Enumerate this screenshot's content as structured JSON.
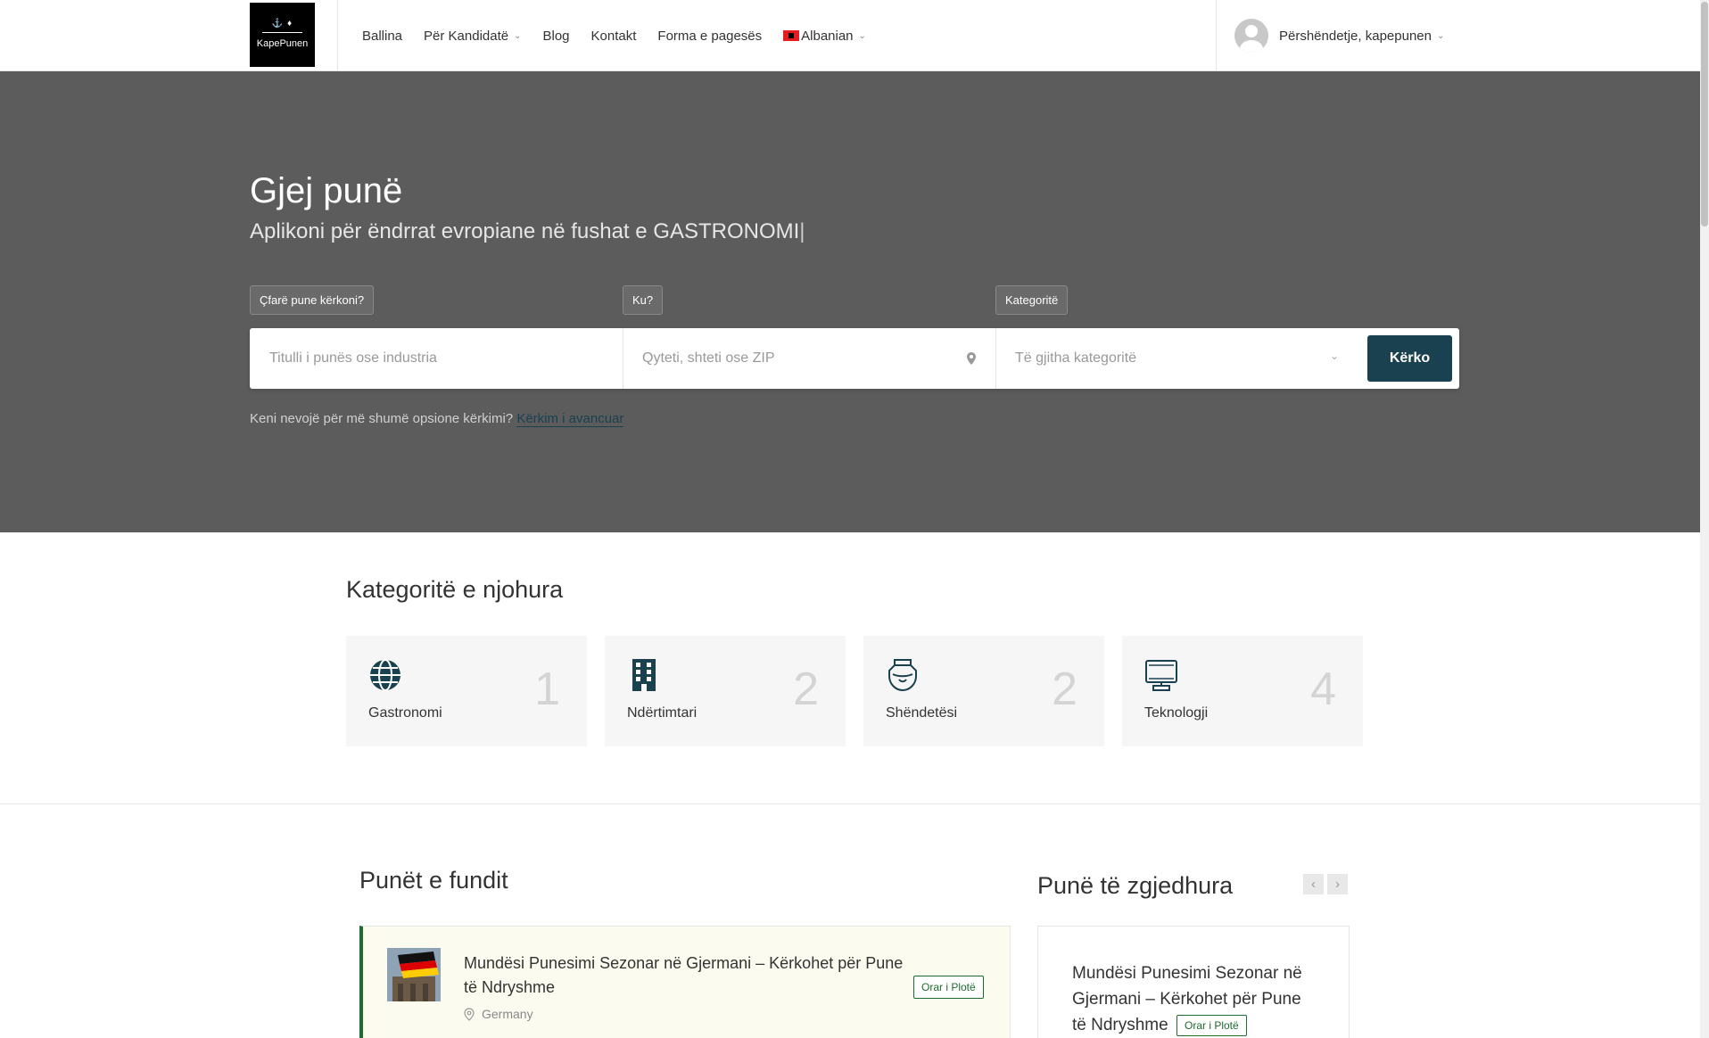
{
  "header": {
    "logo_text": "KapePunen",
    "logo_glyph": "⚓ ♦",
    "nav": [
      {
        "label": "Ballina"
      },
      {
        "label": "Për Kandidatë"
      },
      {
        "label": "Blog"
      },
      {
        "label": "Kontakt"
      },
      {
        "label": "Forma e pagesës"
      },
      {
        "label": "Albanian"
      }
    ],
    "user_greeting": "Përshëndetje, kapepunen"
  },
  "hero": {
    "title": "Gjej punë",
    "subtitle": "Aplikoni për ëndrrat evropiane në fushat e GASTRONOMI",
    "caret": "|",
    "labels": {
      "what": "Çfarë pune kërkoni?",
      "where": "Ku?",
      "category": "Kategoritë"
    },
    "search": {
      "keyword_placeholder": "Titulli i punës ose industria",
      "location_placeholder": "Qyteti, shteti ose ZIP",
      "category_value": "Të gjitha kategoritë",
      "button": "Kërko"
    },
    "advanced_prompt": "Keni nevojë për më shumë opsione kërkimi?",
    "advanced_link": "Kërkim i avancuar"
  },
  "categories": {
    "title": "Kategoritë e njohura",
    "items": [
      {
        "name": "Gastronomi",
        "count": "1",
        "icon": "globe-icon"
      },
      {
        "name": "Ndërtimtari",
        "count": "2",
        "icon": "building-icon"
      },
      {
        "name": "Shëndetësi",
        "count": "2",
        "icon": "health-icon"
      },
      {
        "name": "Teknologji",
        "count": "4",
        "icon": "computer-icon"
      }
    ]
  },
  "recent_jobs": {
    "title": "Punët e fundit",
    "items": [
      {
        "title": "Mundësi Punesimi Sezonar në Gjermani – Kërkohet për Pune të Ndryshme",
        "location": "Germany",
        "type": "Orar i Plotë"
      }
    ]
  },
  "featured_jobs": {
    "title": "Punë të zgjedhura",
    "prev": "‹",
    "next": "›",
    "items": [
      {
        "title": "Mundësi Punesimi Sezonar në Gjermani – Kërkohet për Pune të Ndryshme",
        "type": "Orar i Plotë"
      }
    ]
  },
  "colors": {
    "accent": "#1a4150",
    "hero_bg": "#5c5c5c",
    "badge_green": "#1e6b2e"
  }
}
